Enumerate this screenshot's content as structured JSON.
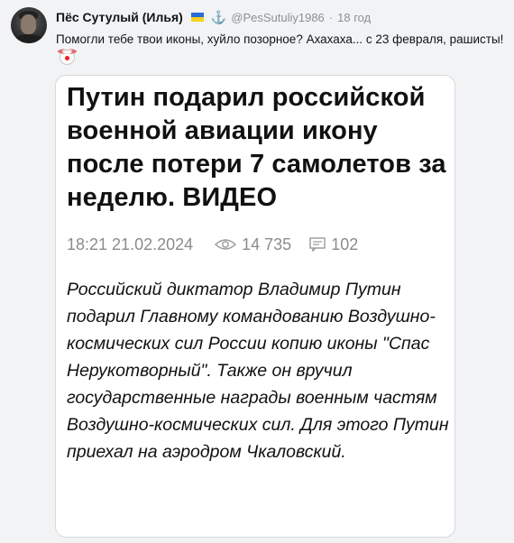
{
  "tweet": {
    "author_name": "Пёс Сутулый (Илья)",
    "handle": "@PesSutuliy1986",
    "separator": "·",
    "time": "18 год",
    "text": "Помогли тебе твои иконы, хуйло позорное? Ахахаха... с 23 февраля, рашисты!",
    "icons": [
      "ukraine-flag-icon",
      "anchor-icon",
      "clown-emoji-icon"
    ]
  },
  "card": {
    "title": "Путин подарил российской военной авиации икону после потери 7 самолетов за неделю. ВИДЕО",
    "datetime": "18:21 21.02.2024",
    "views": "14 735",
    "comments": "102",
    "lead": "Российский диктатор Владимир Путин подарил Главному командованию Воздушно-космических сил России копию иконы \"Спас Нерукотворный\". Также он вручил государственные награды военным частям Воздушно-космических сил. Для этого Путин приехал на аэродром Чкаловский.",
    "colors": {
      "meta": "#8c8c8c",
      "title": "#111111"
    }
  }
}
